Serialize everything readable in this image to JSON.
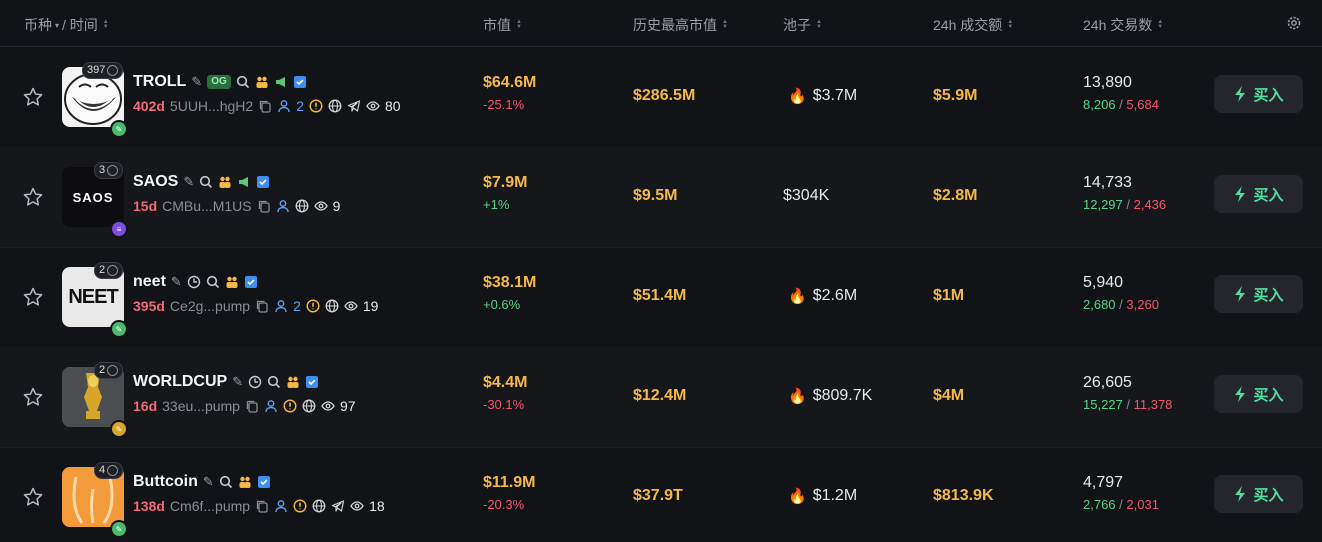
{
  "header": {
    "coin_time": "币种",
    "time": "/ 时间",
    "market_cap": "市值",
    "ath_market_cap": "历史最高市值",
    "pool": "池子",
    "volume_24h": "24h 成交额",
    "trades_24h": "24h 交易数"
  },
  "buy_label": "买入",
  "rows": [
    {
      "avatar_count": "397",
      "name": "TROLL",
      "og": "OG",
      "age": "402d",
      "address": "5UUH...hgH2",
      "holders": "2",
      "watchers": "80",
      "market_cap": "$64.6M",
      "change": "-25.1%",
      "ath": "$286.5M",
      "pool": "$3.7M",
      "volume": "$5.9M",
      "trades": "13,890",
      "buys": "8,206",
      "sells": "5,684"
    },
    {
      "avatar_count": "3",
      "name": "SAOS",
      "avatar_text": "SAOS",
      "age": "15d",
      "address": "CMBu...M1US",
      "holders": "",
      "watchers": "9",
      "market_cap": "$7.9M",
      "change": "+1%",
      "ath": "$9.5M",
      "pool": "$304K",
      "volume": "$2.8M",
      "trades": "14,733",
      "buys": "12,297",
      "sells": "2,436"
    },
    {
      "avatar_count": "2",
      "name": "neet",
      "avatar_text": "NEET",
      "age": "395d",
      "address": "Ce2g...pump",
      "holders": "2",
      "watchers": "19",
      "market_cap": "$38.1M",
      "change": "+0.6%",
      "ath": "$51.4M",
      "pool": "$2.6M",
      "volume": "$1M",
      "trades": "5,940",
      "buys": "2,680",
      "sells": "3,260"
    },
    {
      "avatar_count": "2",
      "name": "WORLDCUP",
      "age": "16d",
      "address": "33eu...pump",
      "holders": "",
      "watchers": "97",
      "market_cap": "$4.4M",
      "change": "-30.1%",
      "ath": "$12.4M",
      "pool": "$809.7K",
      "volume": "$4M",
      "trades": "26,605",
      "buys": "15,227",
      "sells": "11,378"
    },
    {
      "avatar_count": "4",
      "name": "Buttcoin",
      "age": "138d",
      "address": "Cm6f...pump",
      "holders": "",
      "watchers": "18",
      "market_cap": "$11.9M",
      "change": "-20.3%",
      "ath": "$37.9T",
      "pool": "$1.2M",
      "volume": "$813.9K",
      "trades": "4,797",
      "buys": "2,766",
      "sells": "2,031"
    }
  ],
  "colors": {
    "accent_yellow": "#f5b94a",
    "negative": "#f4566f",
    "positive": "#58d58a",
    "buy_green": "#4fe0a0"
  }
}
